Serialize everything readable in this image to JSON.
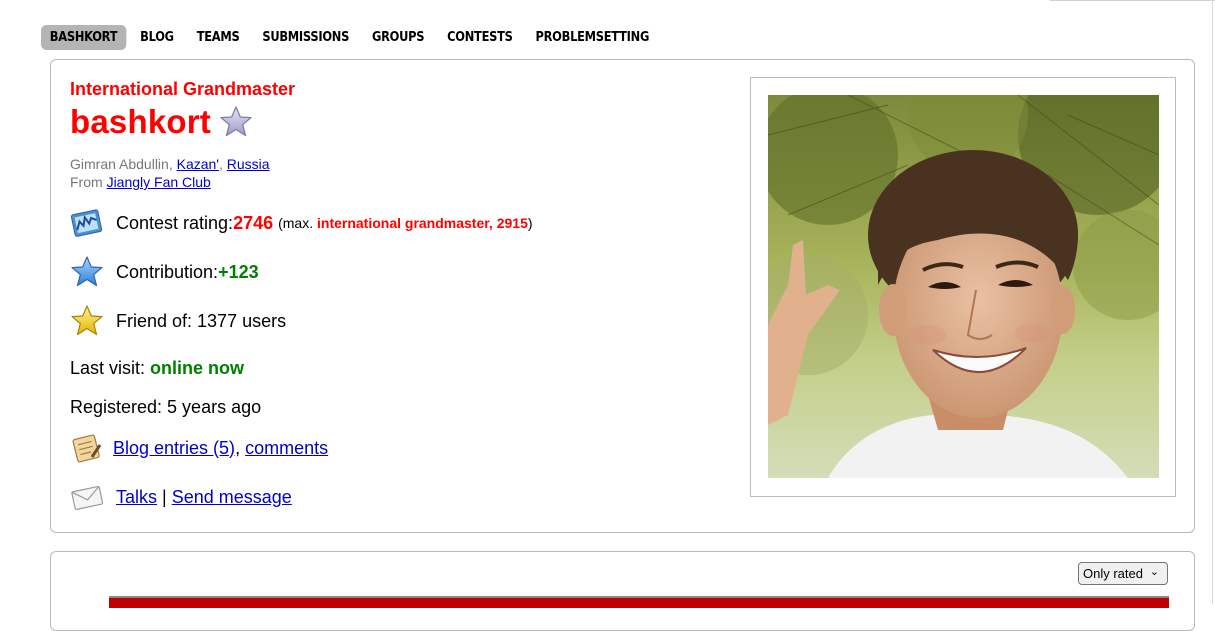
{
  "menu": {
    "items": [
      {
        "label": "BASHKORT",
        "active": true
      },
      {
        "label": "BLOG",
        "active": false
      },
      {
        "label": "TEAMS",
        "active": false
      },
      {
        "label": "SUBMISSIONS",
        "active": false
      },
      {
        "label": "GROUPS",
        "active": false
      },
      {
        "label": "CONTESTS",
        "active": false
      },
      {
        "label": "PROBLEMSETTING",
        "active": false
      }
    ]
  },
  "profile": {
    "rank": "International Grandmaster",
    "handle": "bashkort",
    "star_icon": "star-outline-icon",
    "name": "Gimran Abdullin, ",
    "city": "Kazan'",
    "separator": ", ",
    "country": "Russia",
    "from_label": "From ",
    "organization": "Jiangly Fan Club",
    "rating_label": "Contest rating: ",
    "rating_value": "2746",
    "max_prefix": "(max. ",
    "max_rank_rating": "international grandmaster, 2915",
    "max_suffix": ")",
    "contribution_label": "Contribution: ",
    "contribution_value": "+123",
    "friend_label": "Friend of: 1377 users",
    "last_visit_label": "Last visit: ",
    "last_visit_value": "online now",
    "registered_label": "Registered: 5 years ago",
    "blog_link": "Blog entries (5)",
    "comma": ", ",
    "comments_link": "comments",
    "talks_link": "Talks",
    "pipe": " | ",
    "send_message_link": "Send message"
  },
  "graph": {
    "select_value": "Only rated",
    "chevron": "⌄"
  },
  "colors": {
    "red_rank": "#ff0000",
    "green": "#008000",
    "link": "#0000cc"
  }
}
